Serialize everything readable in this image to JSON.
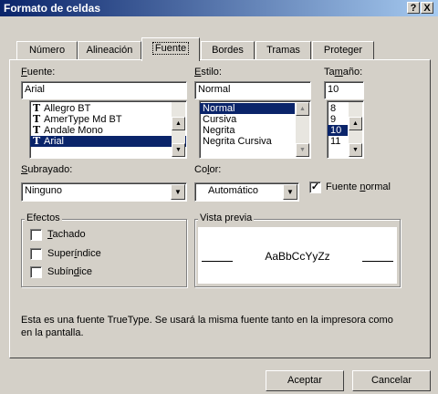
{
  "window": {
    "title": "Formato de celdas",
    "help_label": "?",
    "close_label": "X"
  },
  "tabs": [
    {
      "label": "Número"
    },
    {
      "label": "Alineación"
    },
    {
      "label": "Fuente"
    },
    {
      "label": "Bordes"
    },
    {
      "label": "Tramas"
    },
    {
      "label": "Proteger"
    }
  ],
  "active_tab": "Fuente",
  "font": {
    "label_pre": "",
    "label_u": "F",
    "label_post": "uente:",
    "value": "Arial",
    "list": [
      "Allegro BT",
      "AmerType Md BT",
      "Andale Mono",
      "Arial"
    ],
    "selected": "Arial"
  },
  "style": {
    "label_u": "E",
    "label_post": "stilo:",
    "value": "Normal",
    "list": [
      "Normal",
      "Cursiva",
      "Negrita",
      "Negrita Cursiva"
    ],
    "selected": "Normal"
  },
  "size": {
    "label_pre": "Ta",
    "label_u": "m",
    "label_post": "año:",
    "value": "10",
    "list": [
      "8",
      "9",
      "10",
      "11"
    ],
    "selected": "10"
  },
  "underline": {
    "label_u": "S",
    "label_post": "ubrayado:",
    "value": "Ninguno"
  },
  "color": {
    "label_pre": "Co",
    "label_u": "l",
    "label_post": "or:",
    "value": "Automático"
  },
  "normal_font": {
    "label_pre": "Fuente ",
    "label_u": "n",
    "label_post": "ormal",
    "checked": "✓"
  },
  "effects": {
    "legend": "Efectos",
    "strike": {
      "label_u": "T",
      "label_post": "achado"
    },
    "super": {
      "label_pre": "Super",
      "label_u": "í",
      "label_post": "ndice"
    },
    "sub": {
      "label_pre": "Subín",
      "label_u": "d",
      "label_post": "ice"
    }
  },
  "preview": {
    "legend": "Vista previa",
    "sample": "AaBbCcYyZz"
  },
  "info_text": "Esta es una fuente TrueType. Se usará la misma fuente tanto en la impresora como en la pantalla.",
  "buttons": {
    "ok": "Aceptar",
    "cancel": "Cancelar"
  },
  "colors": {
    "title_start": "#0a246a",
    "title_end": "#a6caf0",
    "face": "#d4d0c8",
    "selection": "#0a246a"
  }
}
